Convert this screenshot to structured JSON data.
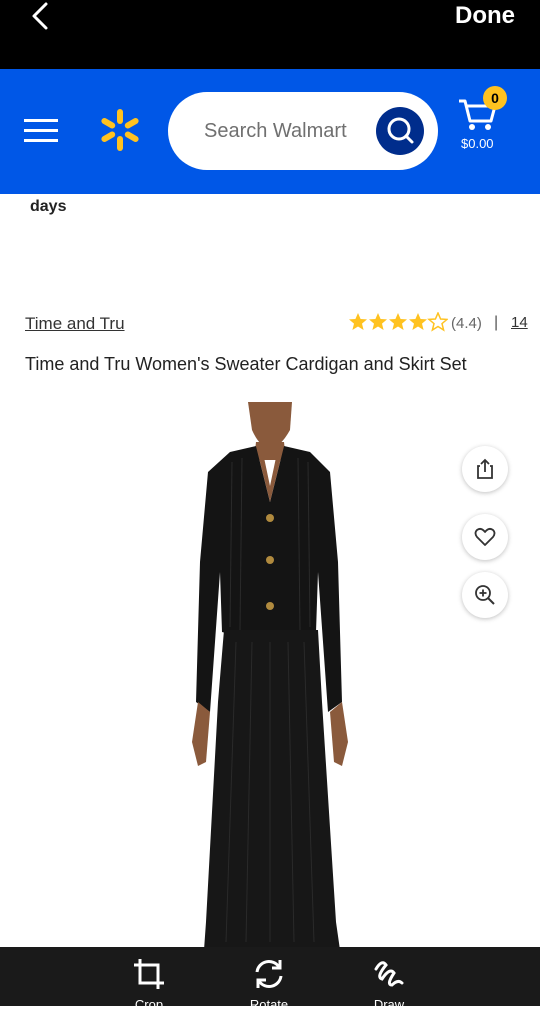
{
  "top_bar": {
    "done_label": "Done"
  },
  "header": {
    "search_placeholder": "Search Walmart",
    "cart_count": "0",
    "cart_total": "$0.00"
  },
  "banner": {
    "days_text": "days"
  },
  "product": {
    "brand": "Time and Tru",
    "rating_value": "(4.4)",
    "separator": "|",
    "review_count": "14",
    "title": "Time and Tru Women's Sweater Cardigan and Skirt Set"
  },
  "editor_tools": {
    "crop_label": "Crop",
    "rotate_label": "Rotate",
    "draw_label": "Draw"
  },
  "colors": {
    "walmart_blue": "#0057e7",
    "search_button": "#002d8c",
    "spark_yellow": "#ffc220",
    "star_yellow": "#ffc220"
  }
}
